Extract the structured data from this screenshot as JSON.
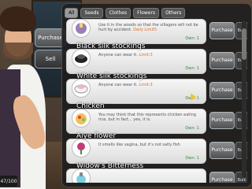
{
  "side_buttons": {
    "purchase": "Purchase",
    "sell": "Sell"
  },
  "counter": "47/100",
  "tabs": [
    "All",
    "Seeds",
    "Clothes",
    "Flowers",
    "Others"
  ],
  "items": [
    {
      "name": "",
      "desc": "Use it in the woods so that the villagers will not be hurt by accident.",
      "highlight": "Daily Limit5",
      "owned": "Own: 1",
      "buy": "Purchase",
      "qty": "Bulk"
    },
    {
      "name": "Black silk stockings",
      "desc": "Anyone can wear it.",
      "highlight": "Limit:3",
      "owned": "Own: 1",
      "buy": "Purchase",
      "qty": "Bulk"
    },
    {
      "name": "White silk stockings",
      "desc": "Anyone can wear it.",
      "highlight": "Limit:3",
      "owned": "Own: 1",
      "buy": "Purchase",
      "qty": "Bulk"
    },
    {
      "name": "Chicken",
      "desc": "You may think that this represents chicken eating rice, but in fact... yes, it is.",
      "highlight": "",
      "owned": "Own: 1",
      "buy": "Purchase",
      "qty": "Bulk"
    },
    {
      "name": "Aiye flower",
      "desc": "It smells like vagina, but it's not salty fish",
      "highlight": "",
      "owned": "Own: 1",
      "buy": "Purchase",
      "qty": "Bulk"
    },
    {
      "name": "Widow's Bitterness",
      "desc": "",
      "highlight": "",
      "owned": "",
      "buy": "Purchase",
      "qty": "Bulk"
    }
  ],
  "colors": {
    "highlight": "#e06d2a",
    "owned": "#2e8a3d"
  },
  "icons": [
    "candle-icon",
    "black-stockings-icon",
    "white-stockings-icon",
    "chicken-icon",
    "aiye-flower-icon",
    "potion-icon"
  ]
}
